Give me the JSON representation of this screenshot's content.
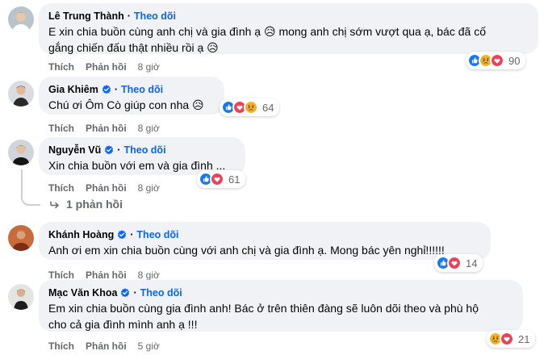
{
  "colors": {
    "accent": "#0866ff",
    "bubble": "#f0f2f5",
    "muted": "#65676b"
  },
  "labels": {
    "follow": "Theo dõi",
    "like": "Thích",
    "reply": "Phản hồi",
    "separator": "·"
  },
  "comments": [
    {
      "author": "Lê Trung Thành",
      "verified": false,
      "text_line1": "E xin chia buồn cùng anh chị và gia đình ạ 😥 mong anh chị sớm vượt qua ạ, bác đã cố",
      "text_line2": "gắng chiến đấu thật nhiều rồi ạ 😥",
      "reaction_icons": [
        "like-icon",
        "sad-icon",
        "love-icon"
      ],
      "reaction_count": "90",
      "time": "8 giờ"
    },
    {
      "author": "Gia Khiêm",
      "verified": true,
      "text_line1": "Chú ơi Ôm Cò giúp con nha 😥",
      "reaction_icons": [
        "like-icon",
        "love-icon",
        "sad-icon"
      ],
      "reaction_count": "64",
      "time": "8 giờ"
    },
    {
      "author": "Nguyễn Vũ",
      "verified": true,
      "text_line1": "Xin chia buồn với em và gia đình ...",
      "reaction_icons": [
        "like-icon",
        "love-icon"
      ],
      "reaction_count": "61",
      "time": "8 giờ",
      "replies_label": "1 phản hồi"
    },
    {
      "author": "Khánh Hoàng",
      "verified": true,
      "text_line1": "Anh ơi em xin chia buồn cùng với anh chị và gia đình ạ. Mong bác yên nghỉ!!!!!!",
      "reaction_icons": [
        "like-icon",
        "love-icon"
      ],
      "reaction_count": "14",
      "time": "8 giờ"
    },
    {
      "author": "Mạc Văn Khoa",
      "verified": true,
      "text_line1": "Em xin chia buồn cùng gia đình anh! Bác ở trên thiên đàng sẽ luôn dõi theo và phù hộ",
      "text_line2": "cho cả gia đình mình anh ạ !!!",
      "reaction_icons": [
        "sad-icon",
        "love-icon"
      ],
      "reaction_count": "21",
      "time": "5 giờ"
    }
  ]
}
